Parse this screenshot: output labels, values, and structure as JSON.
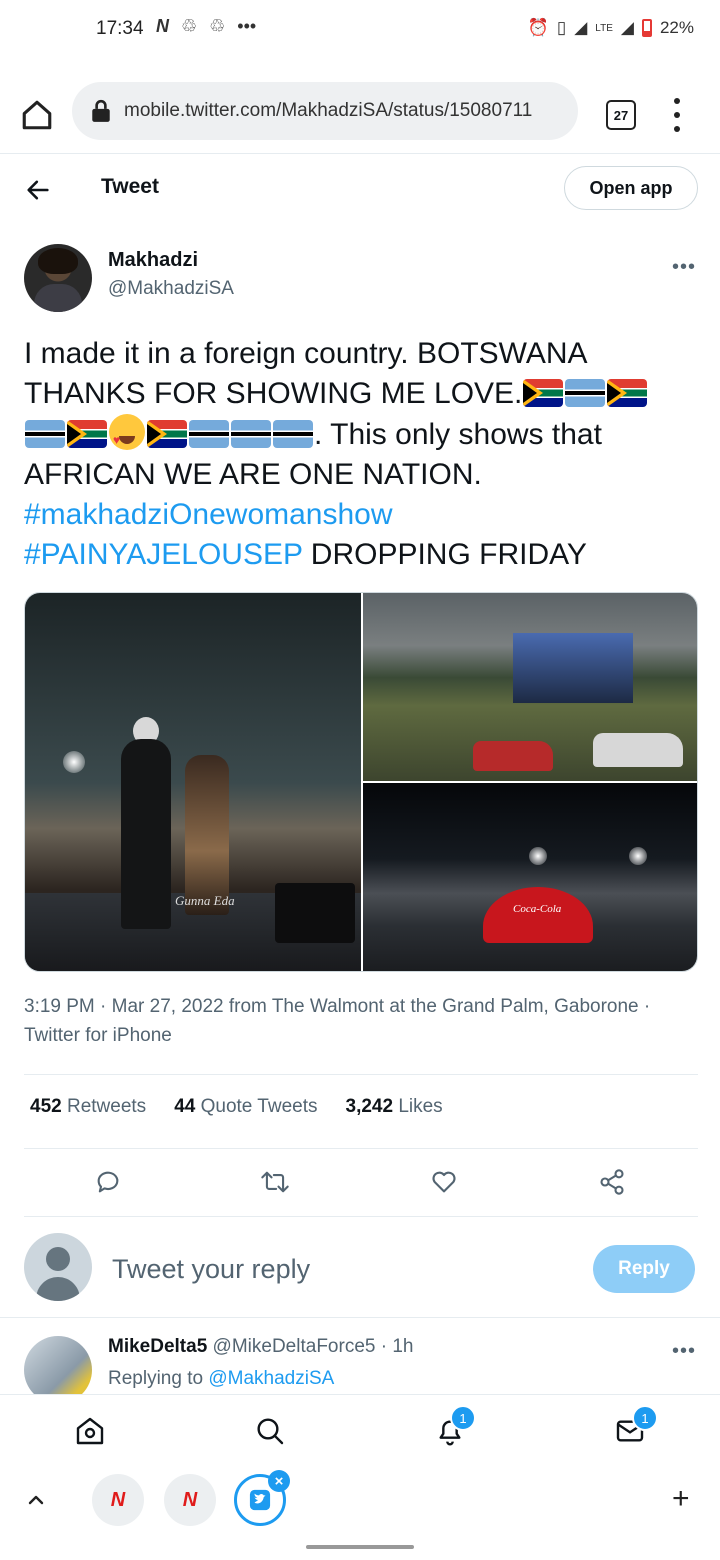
{
  "status_bar": {
    "time": "17:34",
    "network": "LTE",
    "battery": "22%"
  },
  "browser": {
    "url": "mobile.twitter.com/MakhadziSA/status/15080711",
    "tab_count": "27"
  },
  "header": {
    "title": "Tweet",
    "open_app": "Open app"
  },
  "author": {
    "name": "Makhadzi",
    "handle": "@MakhadziSA",
    "more": "•••"
  },
  "tweet": {
    "line1": "I made it in a foreign country. BOTSWANA THANKS FOR SHOWING ME LOVE.",
    "line2": ". This only shows that AFRICAN WE ARE ONE NATION.",
    "hashtag1": "#makhadziOnewomanshow",
    "hashtag2": "#PAINYAJELOUSEP",
    "line3": " DROPPING FRIDAY"
  },
  "media": {
    "watermark": "Gunna Eda",
    "brand_sign": "Coca-Cola"
  },
  "meta": {
    "timestamp": "3:19 PM · Mar 27, 2022 from The Walmont at the Grand Palm, Gaborone · Twitter for iPhone"
  },
  "stats": {
    "retweets_count": "452",
    "retweets_label": "Retweets",
    "quotes_count": "44",
    "quotes_label": "Quote Tweets",
    "likes_count": "3,242",
    "likes_label": "Likes"
  },
  "composer": {
    "placeholder": "Tweet your reply",
    "reply_button": "Reply"
  },
  "reply_preview": {
    "name": "MikeDelta5",
    "handle": " @MikeDeltaForce5 · 1h",
    "replying_prefix": "Replying to ",
    "replying_handle": "@MakhadziSA"
  },
  "twitter_nav": {
    "notifications_badge": "1",
    "messages_badge": "1"
  },
  "browser_tabs": {
    "tab1_label": "N",
    "tab2_label": "N",
    "add": "+"
  },
  "colors": {
    "accent": "#1d9bf0",
    "muted": "#536471",
    "reply_button": "#8ecdf7"
  }
}
